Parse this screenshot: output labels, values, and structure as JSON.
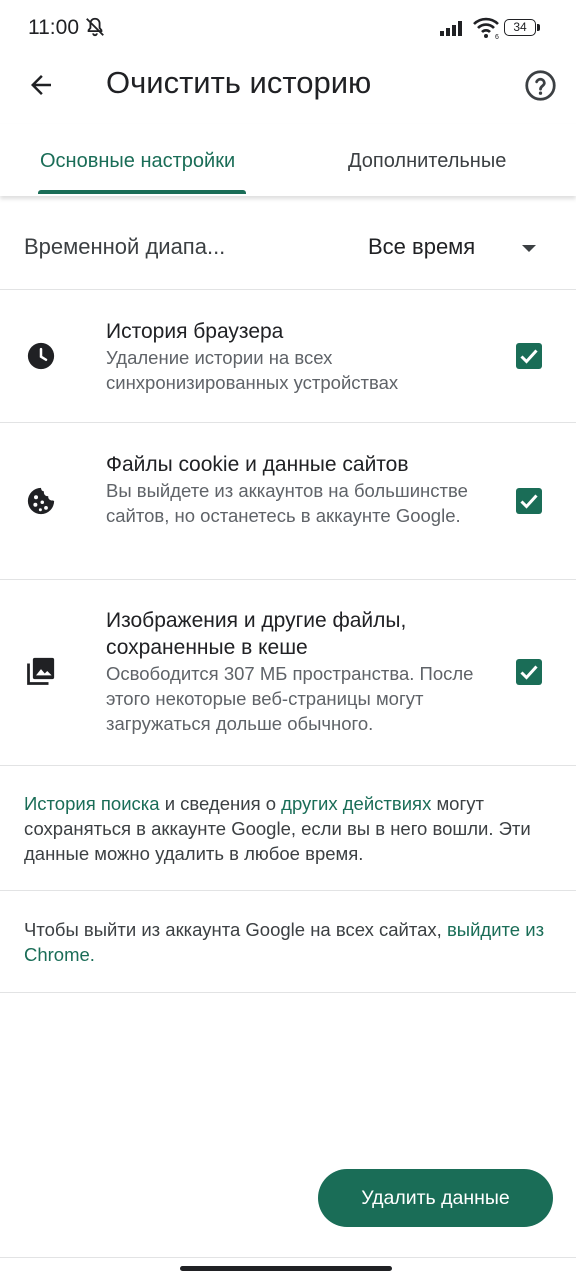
{
  "status_bar": {
    "time": "11:00",
    "battery": "34",
    "icons": [
      "mute-icon",
      "signal-icon",
      "wifi-icon",
      "battery-icon"
    ]
  },
  "app_bar": {
    "title": "Очистить историю",
    "back_icon": "arrow-left-icon",
    "help_icon": "help-circle-icon"
  },
  "tabs": [
    {
      "label": "Основные настройки",
      "selected": true
    },
    {
      "label": "Дополнительные",
      "selected": false
    }
  ],
  "time_range": {
    "label": "Временной диапа...",
    "value": "Все время"
  },
  "options": [
    {
      "icon": "clock-icon",
      "title": "История браузера",
      "description": "Удаление истории на всех синхронизированных устройствах",
      "checked": true
    },
    {
      "icon": "cookie-icon",
      "title": "Файлы cookie и данные сайтов",
      "description": "Вы выйдете из аккаунтов на большинстве сайтов, но останетесь в аккаунте Google.",
      "checked": true
    },
    {
      "icon": "images-icon",
      "title": "Изображения и другие файлы, сохраненные в кеше",
      "description": "Освободится 307 МБ пространства. После этого некоторые веб-страницы могут загружаться дольше обычного.",
      "checked": true
    }
  ],
  "info_search": {
    "link_search_history": "История поиска",
    "text_and": " и сведения о ",
    "link_other_activity": "других действиях",
    "text_rest": " могут сохраняться в аккаунте Google, если вы в него вошли. Эти данные можно удалить в любое время."
  },
  "info_signout": {
    "text": "Чтобы выйти из аккаунта Google на всех сайтах, ",
    "link": "выйдите из Chrome."
  },
  "clear_button_label": "Удалить данные",
  "colors": {
    "accent": "#1a6d57",
    "text_primary": "#202124",
    "text_secondary": "#5f6368",
    "divider": "#e2e3e4"
  }
}
